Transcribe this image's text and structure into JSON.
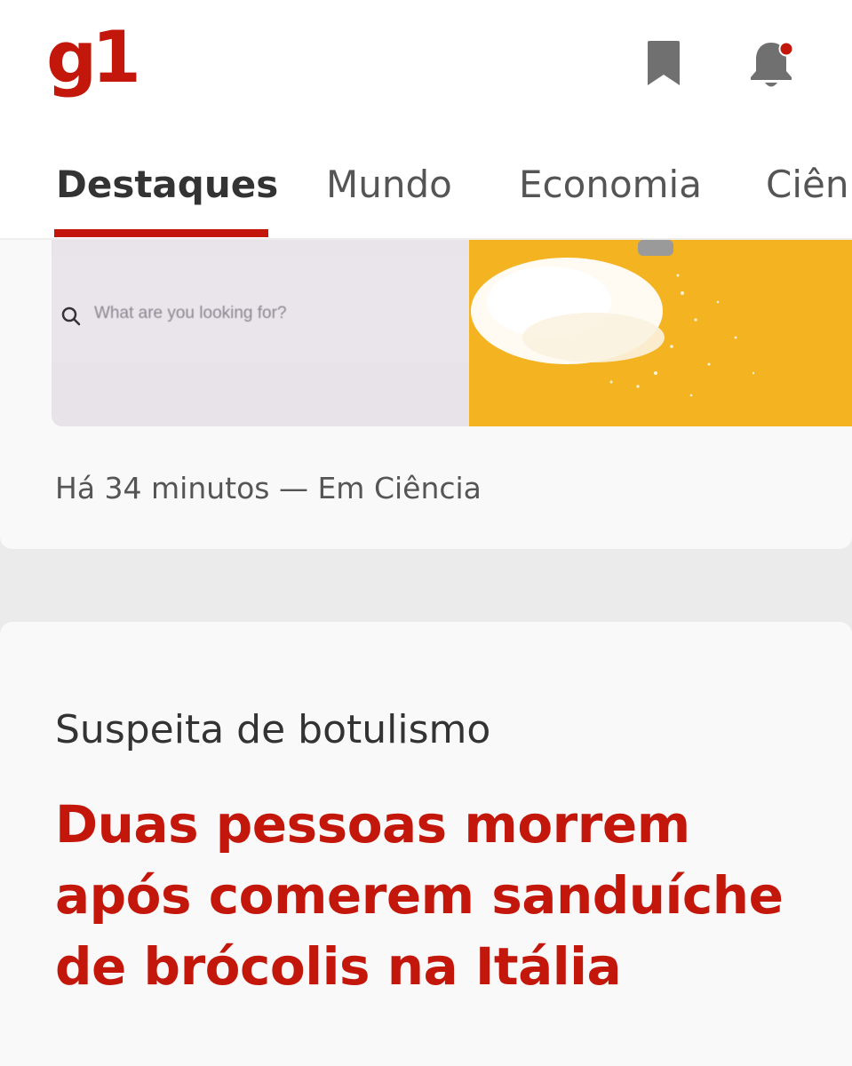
{
  "header": {
    "logo": "g1",
    "icons": [
      "bookmark-icon",
      "bell-icon"
    ],
    "brand_color": "#c4170c",
    "notification_dot_color": "#c4170c"
  },
  "tabs": [
    {
      "label": "Destaques",
      "active": true
    },
    {
      "label": "Mundo",
      "active": false
    },
    {
      "label": "Economia",
      "active": false
    },
    {
      "label": "Ciên",
      "active": false
    }
  ],
  "card1": {
    "image_search_placeholder": "What are you looking for?",
    "meta": "Há 34 minutos — Em Ciência"
  },
  "card2": {
    "chapeu": "Suspeita de botulismo",
    "headline": "Duas pessoas morrem após comerem sanduíche de brócolis na Itália"
  }
}
